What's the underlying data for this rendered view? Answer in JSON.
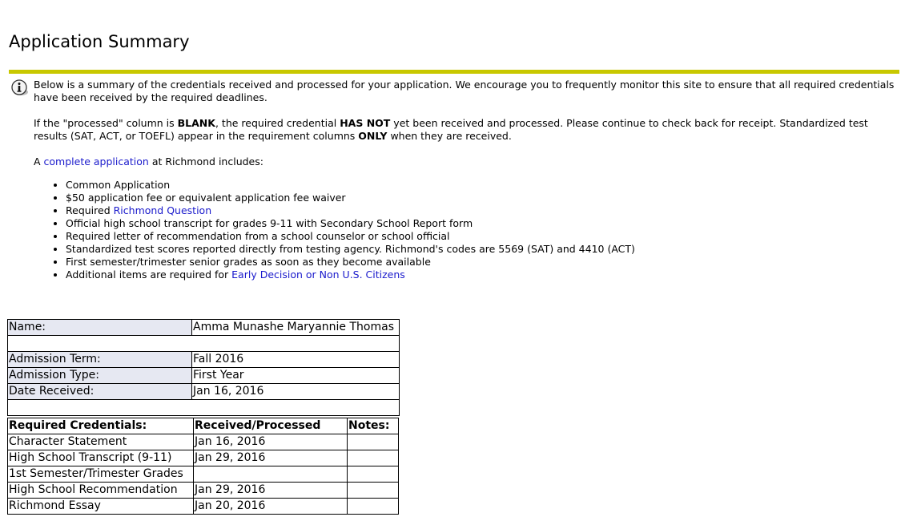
{
  "page": {
    "title": "Application Summary"
  },
  "intro": {
    "text": "Below is a summary of the credentials received and processed for your application. We encourage you to frequently monitor this site to ensure that all required credentials have been received by the required deadlines."
  },
  "processed_note": {
    "part1": "If the \"processed\" column is ",
    "blank": "BLANK",
    "part2": ", the required credential ",
    "has_not": "HAS NOT",
    "part3": " yet been received and processed. Please continue to check back for receipt. Standardized test results (SAT, ACT, or TOEFL) appear in the requirement columns ",
    "only": "ONLY",
    "part4": " when they are received."
  },
  "complete_app": {
    "prefix": "A ",
    "link": "complete application",
    "suffix": " at Richmond includes:"
  },
  "requirements": [
    {
      "text": "Common Application"
    },
    {
      "text": "$50 application fee or equivalent application fee waiver"
    },
    {
      "text": "Required ",
      "link": "Richmond Question"
    },
    {
      "text": "Official high school transcript for grades 9-11 with Secondary School Report form"
    },
    {
      "text": "Required letter of recommendation from a school counselor or school official"
    },
    {
      "text": "Standardized test scores reported directly from testing agency. Richmond's codes are 5569 (SAT) and 4410 (ACT)"
    },
    {
      "text": "First semester/trimester senior grades as soon as they become available"
    },
    {
      "text": "Additional items are required for ",
      "link": "Early Decision or Non U.S. Citizens"
    }
  ],
  "applicant": {
    "name_label": "Name:",
    "name_value": "Amma Munashe Maryannie Thomas",
    "term_label": "Admission Term:",
    "term_value": "Fall 2016",
    "type_label": "Admission Type:",
    "type_value": "First Year",
    "date_label": "Date Received:",
    "date_value": "Jan 16, 2016"
  },
  "credentials": {
    "headers": [
      "Required Credentials:",
      "Received/Processed",
      "Notes:"
    ],
    "rows": [
      {
        "name": "Character Statement",
        "received": "Jan 16, 2016",
        "notes": ""
      },
      {
        "name": "High School Transcript (9-11)",
        "received": "Jan 29, 2016",
        "notes": ""
      },
      {
        "name": "1st Semester/Trimester Grades",
        "received": "",
        "notes": ""
      },
      {
        "name": "High School Recommendation",
        "received": "Jan 29, 2016",
        "notes": ""
      },
      {
        "name": "Richmond Essay",
        "received": "Jan 20, 2016",
        "notes": ""
      }
    ]
  },
  "icons": {
    "info": "info-icon"
  }
}
